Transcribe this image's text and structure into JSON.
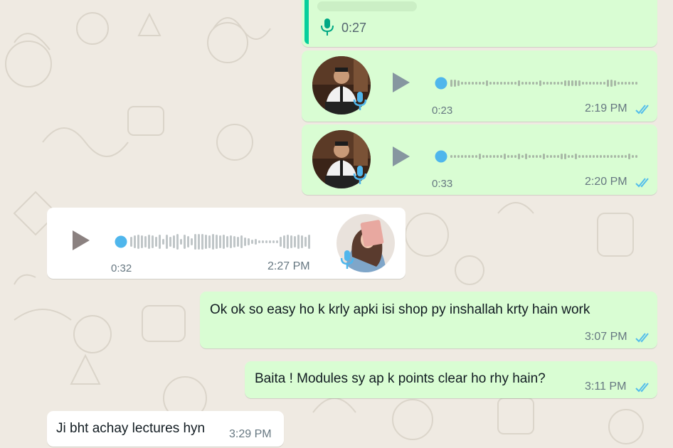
{
  "colors": {
    "outgoing_bubble": "#d9fdd3",
    "incoming_bubble": "#ffffff",
    "read_ticks": "#53bdeb",
    "wave_dot": "#4fb6ec",
    "quote_bar": "#06cf9c",
    "mic_green": "#00a884",
    "background": "#efeae2"
  },
  "quoted_message": {
    "duration": "0:27",
    "icon": "mic-icon"
  },
  "messages": [
    {
      "type": "voice",
      "direction": "outgoing",
      "duration": "0:23",
      "time": "2:19 PM",
      "status": "read",
      "avatar": "sender-avatar",
      "progress": 0
    },
    {
      "type": "voice",
      "direction": "outgoing",
      "duration": "0:33",
      "time": "2:20 PM",
      "status": "read",
      "avatar": "sender-avatar",
      "progress": 0
    },
    {
      "type": "voice",
      "direction": "incoming",
      "duration": "0:32",
      "time": "2:27 PM",
      "avatar": "contact-avatar",
      "progress": 0
    },
    {
      "type": "text",
      "direction": "outgoing",
      "text": "Ok ok so easy ho k krly apki isi shop py inshallah krty hain work",
      "time": "3:07 PM",
      "status": "read"
    },
    {
      "type": "text",
      "direction": "outgoing",
      "text": "Baita ! Modules sy ap k points clear ho rhy hain?",
      "time": "3:11 PM",
      "status": "read"
    },
    {
      "type": "text",
      "direction": "incoming",
      "text": "Ji bht achay lectures hyn",
      "time": "3:29 PM"
    }
  ]
}
